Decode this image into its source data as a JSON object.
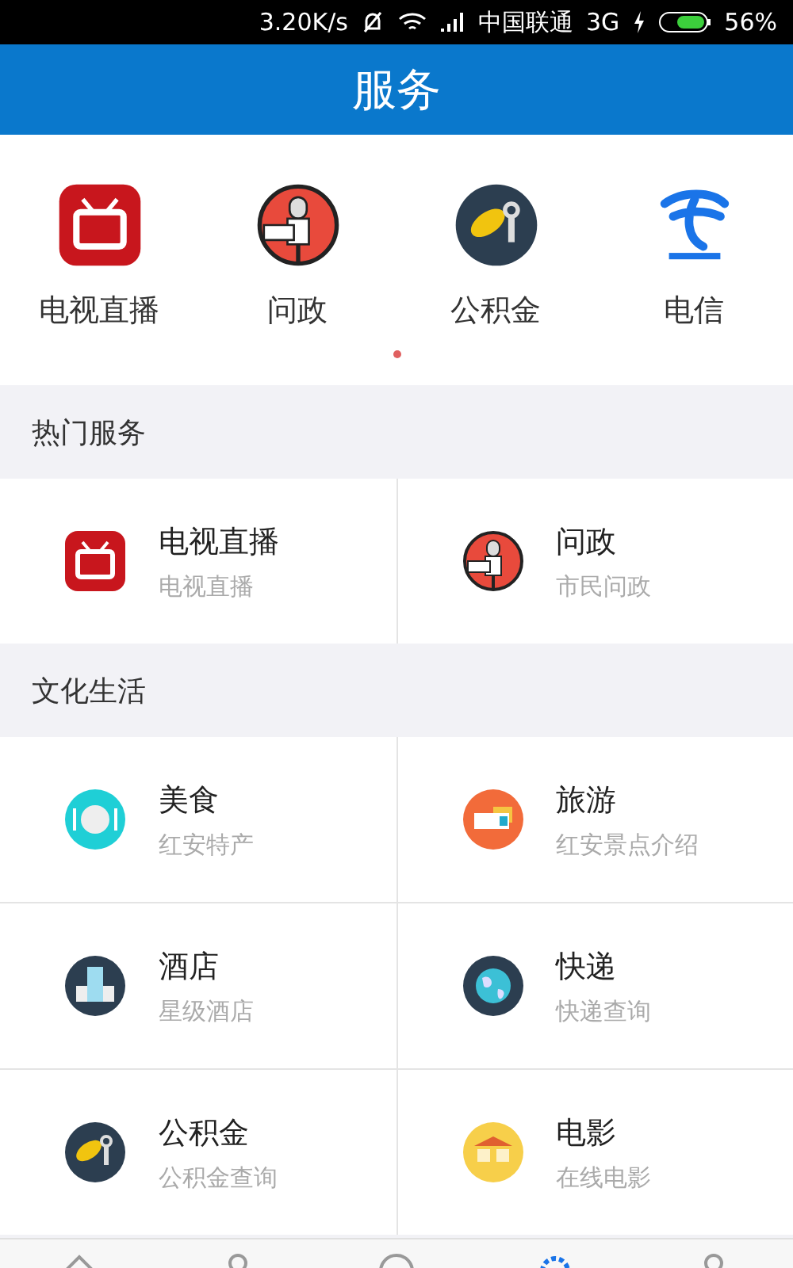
{
  "status_bar": {
    "speed": "3.20K/s",
    "carrier": "中国联通",
    "network": "3G",
    "battery": "56%"
  },
  "header": {
    "title": "服务"
  },
  "quick_services": [
    {
      "kind": "tv",
      "label": "电视直播"
    },
    {
      "kind": "mic",
      "label": "问政"
    },
    {
      "kind": "key",
      "label": "公积金"
    },
    {
      "kind": "telecom",
      "label": "电信"
    }
  ],
  "page_dots": [
    {
      "selected": true
    }
  ],
  "sections": [
    {
      "title": "热门服务",
      "items": [
        {
          "kind": "tv",
          "title": "电视直播",
          "subtitle": "电视直播"
        },
        {
          "kind": "mic",
          "title": "问政",
          "subtitle": "市民问政"
        }
      ]
    },
    {
      "title": "文化生活",
      "items": [
        {
          "kind": "food",
          "title": "美食",
          "subtitle": "红安特产"
        },
        {
          "kind": "travel",
          "title": "旅游",
          "subtitle": "红安景点介绍"
        },
        {
          "kind": "hotel",
          "title": "酒店",
          "subtitle": "星级酒店"
        },
        {
          "kind": "globe",
          "title": "快递",
          "subtitle": "快递查询"
        },
        {
          "kind": "key",
          "title": "公积金",
          "subtitle": "公积金查询"
        },
        {
          "kind": "cinema",
          "title": "电影",
          "subtitle": "在线电影"
        }
      ]
    }
  ],
  "bottom_nav": [
    {
      "kind": "home",
      "selected": false
    },
    {
      "kind": "person",
      "selected": false
    },
    {
      "kind": "circle",
      "selected": false
    },
    {
      "kind": "gear",
      "selected": true
    },
    {
      "kind": "person",
      "selected": false
    }
  ]
}
